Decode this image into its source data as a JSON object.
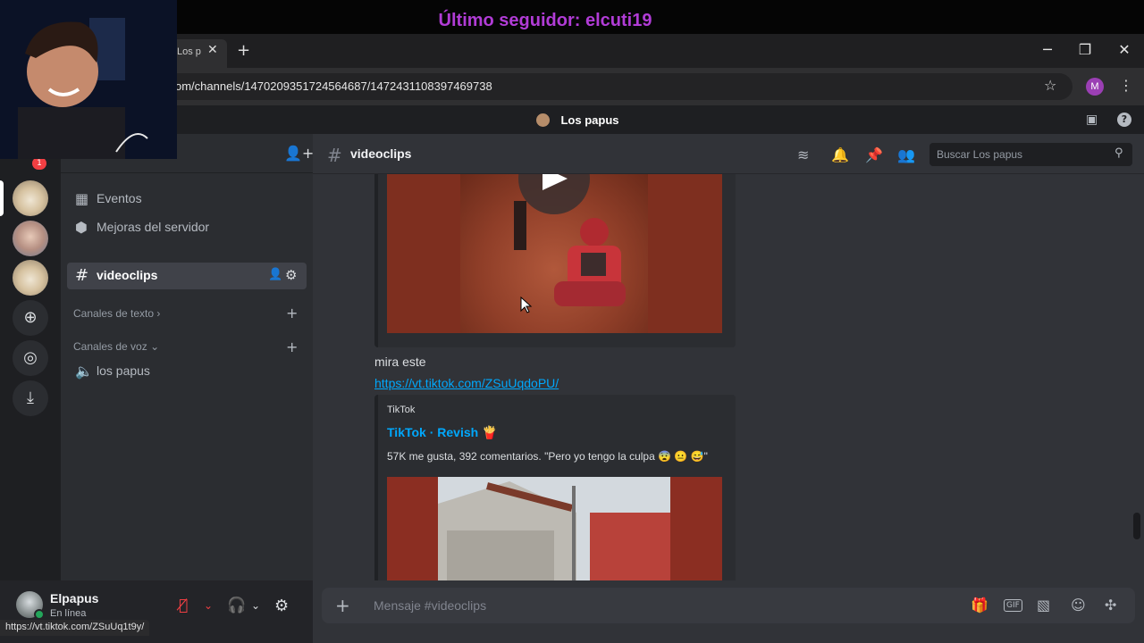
{
  "stream": {
    "overlay_title": "Último seguidor: elcuti19"
  },
  "browser": {
    "tab_title": "Los p",
    "tab_close": "✕",
    "new_tab": "+",
    "url": "om/channels/1470209351724564687/1472431108397469738",
    "profile_initial": "M",
    "status_url": "https://vt.tiktok.com/ZSuUq1t9y/"
  },
  "app": {
    "title": "Los papus"
  },
  "servers": {
    "badge_count": "1"
  },
  "sidebar": {
    "items": [
      {
        "label": "Eventos"
      },
      {
        "label": "Mejoras del servidor"
      }
    ],
    "active_channel": "videoclips",
    "text_category": "Canales de texto",
    "voice_category": "Canales de voz",
    "voice_channel": "los papus"
  },
  "user": {
    "name": "Elpapus",
    "status": "En línea"
  },
  "chat": {
    "channel": "videoclips",
    "search_placeholder": "Buscar Los papus",
    "message_text": "mira este",
    "message_link": "https://vt.tiktok.com/ZSuUqdoPU/",
    "embed": {
      "provider": "TikTok",
      "title": "TikTok · Revish 🍟",
      "description": "57K me gusta, 392 comentarios. \"Pero yo tengo la culpa 😨 😐 😅\""
    },
    "composer_placeholder": "Mensaje #videoclips"
  },
  "colors": {
    "accent_link": "#00a8fc",
    "online": "#23a55a",
    "overlay_purple": "#b13cd6"
  }
}
